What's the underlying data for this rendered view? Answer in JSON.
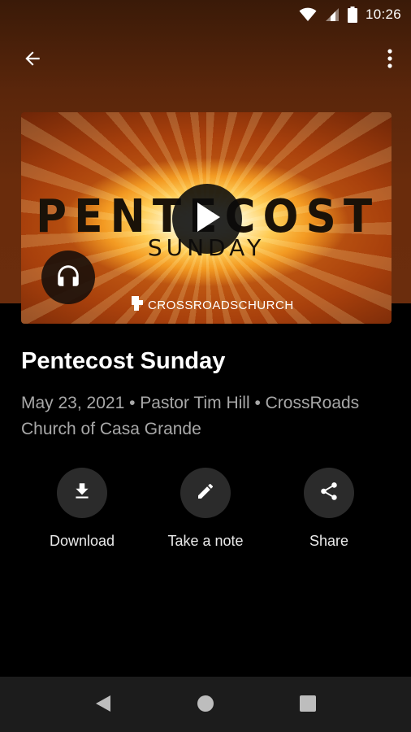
{
  "status_bar": {
    "time": "10:26"
  },
  "artwork": {
    "title": "PENTECOST",
    "subtitle": "SUNDAY",
    "church_logo_text": "CROSSROADSCHURCH"
  },
  "sermon": {
    "title": "Pentecost Sunday",
    "meta": "May 23, 2021 • Pastor Tim Hill • CrossRoads Church of Casa Grande"
  },
  "actions": [
    {
      "label": "Download",
      "icon": "download-icon"
    },
    {
      "label": "Take a note",
      "icon": "pencil-icon"
    },
    {
      "label": "Share",
      "icon": "share-icon"
    }
  ],
  "colors": {
    "header_bg": "#6b2d0d",
    "background": "#000000",
    "action_circle": "#2b2b2b",
    "meta_text": "#a8a8a8",
    "nav_bar": "#1c1c1c"
  }
}
